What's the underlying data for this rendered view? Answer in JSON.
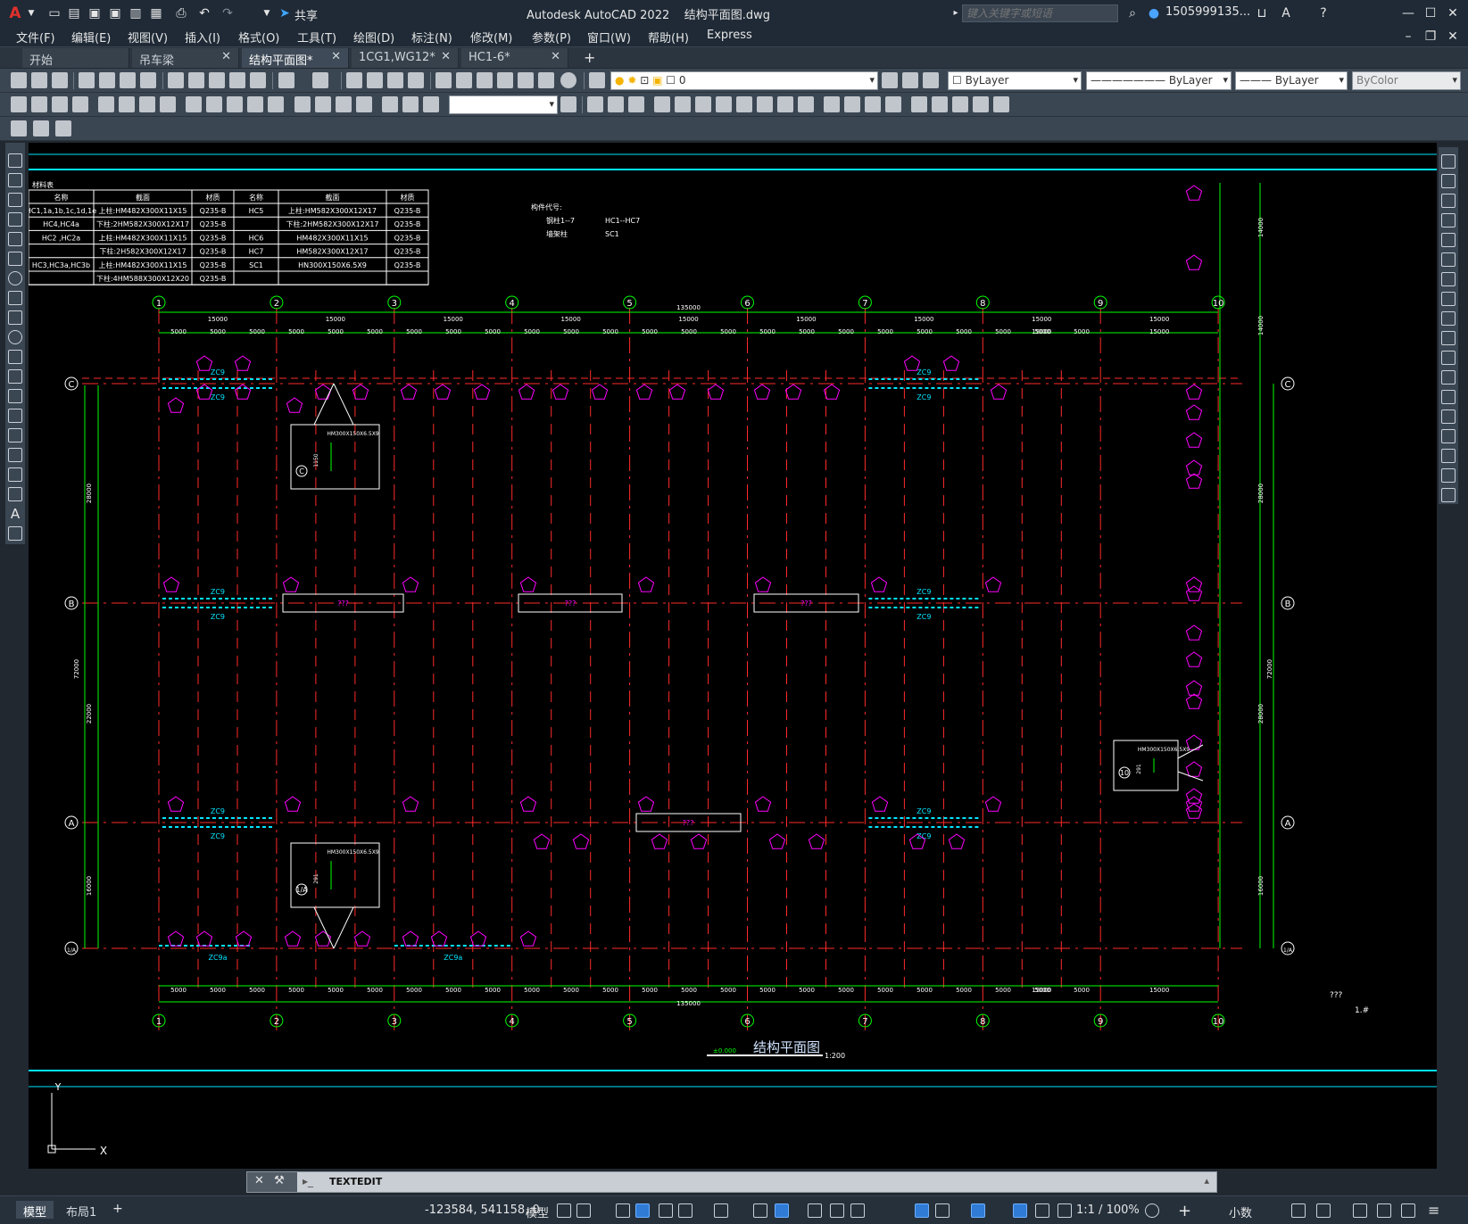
{
  "title_bar": {
    "app_title": "Autodesk AutoCAD 2022",
    "file_name": "结构平面图.dwg",
    "share_label": "共享",
    "search_placeholder": "键入关键字或短语",
    "user_name": "1505999135...",
    "logo_letter": "A"
  },
  "menu": [
    "文件(F)",
    "编辑(E)",
    "视图(V)",
    "插入(I)",
    "格式(O)",
    "工具(T)",
    "绘图(D)",
    "标注(N)",
    "修改(M)",
    "参数(P)",
    "窗口(W)",
    "帮助(H)",
    "Express"
  ],
  "tabs": [
    {
      "label": "开始",
      "closable": false,
      "active": false
    },
    {
      "label": "吊车梁",
      "closable": true,
      "active": false
    },
    {
      "label": "结构平面图*",
      "closable": true,
      "active": true
    },
    {
      "label": "1CG1,WG12*",
      "closable": true,
      "active": false
    },
    {
      "label": "HC1-6*",
      "closable": true,
      "active": false
    }
  ],
  "properties": {
    "layer_value": "0",
    "color": "ByLayer",
    "linetype": "ByLayer",
    "lineweight": "ByLayer",
    "plotstyle": "ByColor",
    "dimstyle_value": ""
  },
  "command_line": {
    "text": "TEXTEDIT"
  },
  "status": {
    "layouts": [
      "模型",
      "布局1"
    ],
    "coordinates": "-123584, 541158, 0",
    "model_label": "模型",
    "scale": "1:1 / 100%",
    "units": "小数"
  },
  "drawing": {
    "material_table": {
      "title": "材料表",
      "headers": [
        "名称",
        "截面",
        "材质",
        "名称",
        "截面",
        "材质"
      ],
      "rows": [
        [
          "HC1,1a,1b,1c,1d,1e",
          "上柱:HM482X300X11X15",
          "Q235-B",
          "HC5",
          "上柱:HM582X300X12X17",
          "Q235-B"
        ],
        [
          "HC4,HC4a",
          "下柱:2HM582X300X12X17",
          "Q235-B",
          "",
          "下柱:2HM582X300X12X17",
          "Q235-B"
        ],
        [
          "HC2 ,HC2a",
          "上柱:HM482X300X11X15",
          "Q235-B",
          "HC6",
          "HM482X300X11X15",
          "Q235-B"
        ],
        [
          "",
          "下柱:2H582X300X12X17",
          "Q235-B",
          "HC7",
          "HM582X300X12X17",
          "Q235-B"
        ],
        [
          "HC3,HC3a,HC3b",
          "上柱:HM482X300X11X15",
          "Q235-B",
          "SC1",
          "HN300X150X6.5X9",
          "Q235-B"
        ],
        [
          "",
          "下柱:4HM588X300X12X20",
          "Q235-B",
          "",
          "",
          ""
        ]
      ]
    },
    "legend": {
      "title": "构件代号:",
      "items": [
        {
          "label": "钢柱1--7",
          "value": "HC1--HC7"
        },
        {
          "label": "墙架柱",
          "value": "SC1"
        }
      ]
    },
    "grid_columns": [
      "1",
      "2",
      "3",
      "4",
      "5",
      "6",
      "7",
      "8",
      "9",
      "10"
    ],
    "grid_rows": [
      "C",
      "B",
      "A",
      "1/A"
    ],
    "overall_dim": "135000",
    "bay_dims": [
      "15000",
      "15000",
      "15000",
      "15000",
      "15000",
      "15000",
      "15000",
      "15000",
      "15000"
    ],
    "sub_dims": [
      "5000",
      "5000",
      "5000",
      "5000",
      "5000",
      "5000",
      "5000",
      "5000",
      "5000",
      "5000",
      "5000",
      "5000",
      "5000",
      "5000",
      "5000",
      "5000",
      "5000",
      "5000",
      "5000",
      "5000",
      "5000",
      "5000",
      "5000",
      "5000",
      "15000",
      "15000"
    ],
    "side_dims": [
      "28000",
      "22000",
      "72000",
      "16000"
    ],
    "right_dims": [
      "14000",
      "14000",
      "28000",
      "72000",
      "28000",
      "16000"
    ],
    "member_tag": "ZC9",
    "member_tag_2": "ZC9a",
    "unknown_text": "???",
    "drawing_title": "结构平面图",
    "scale_text": "1:200",
    "elevation": "±0.000",
    "detail_label": "HM300X150X6.5X9",
    "detail_dim": "1150",
    "detail_dim2": "291",
    "corner_text_1": "???",
    "corner_text_2": "1.#"
  },
  "colors": {
    "canvas": "#000000",
    "grid_line": "#ff2a2a",
    "dimension": "#00ff00",
    "tag": "#ff00ff",
    "brace": "#00e5ff",
    "text": "#ffffff",
    "frame": "#00e5ff"
  }
}
